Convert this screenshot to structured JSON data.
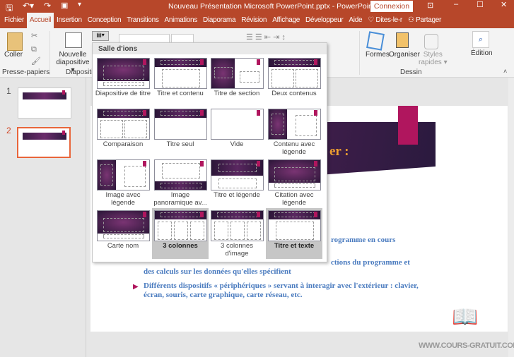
{
  "window": {
    "title": "Nouveau Présentation Microsoft PowerPoint.pptx  -  PowerPoint",
    "signin": "Connexion"
  },
  "tabs": [
    "Fichier",
    "Accueil",
    "Insertion",
    "Conception",
    "Transitions",
    "Animations",
    "Diaporama",
    "Révision",
    "Affichage",
    "Développeur",
    "Aide"
  ],
  "tell_me": "Dites-le-r",
  "share": "Partager",
  "ribbon": {
    "paste": "Coller",
    "new_slide_1": "Nouvelle",
    "new_slide_2": "diapositive ▾",
    "shapes": "Formes",
    "arrange": "Organiser",
    "styles_1": "Styles",
    "styles_2": "rapides ▾",
    "editing": "Édition",
    "groups": {
      "clipboard": "Presse-papiers",
      "slides": "Diapositiv",
      "drawing": "Dessin"
    }
  },
  "thumbnails": [
    {
      "num": "1"
    },
    {
      "num": "2"
    }
  ],
  "layout_gallery": {
    "header": "Salle d'ions",
    "items": [
      {
        "label": "Diapositive de titre",
        "type": "title"
      },
      {
        "label": "Titre et contenu",
        "type": "content"
      },
      {
        "label": "Titre de section",
        "type": "section"
      },
      {
        "label": "Deux contenus",
        "type": "two"
      },
      {
        "label": "Comparaison",
        "type": "two"
      },
      {
        "label": "Titre seul",
        "type": "titleonly"
      },
      {
        "label": "Vide",
        "type": "blank"
      },
      {
        "label": "Contenu avec légende",
        "type": "caption"
      },
      {
        "label": "Image avec légende",
        "type": "caption"
      },
      {
        "label": "Image panoramique av...",
        "type": "pano"
      },
      {
        "label": "Titre et légende",
        "type": "tl"
      },
      {
        "label": "Citation avec légende",
        "type": "title"
      },
      {
        "label": "Carte nom",
        "type": "title"
      },
      {
        "label": "3 colonnes",
        "type": "three",
        "selected": true
      },
      {
        "label": "3 colonnes d'image",
        "type": "three"
      },
      {
        "label": "Titre et texte",
        "type": "content",
        "selected": true
      }
    ]
  },
  "slide": {
    "title_fragment": "er :",
    "bullets": [
      "rogramme en cours",
      "ctions du programme et",
      "des calculs sur les données qu'elles spécifient",
      "Différents dispositifs « périphériques » servant à interagir avec l'extérieur : clavier,",
      "écran, souris, carte graphique, carte réseau, etc."
    ]
  },
  "watermark": "WWW.COURS-GRATUIT.COM",
  "colors": {
    "accent": "#b7472a",
    "slide_title": "#f0a030",
    "bullet_text": "#4a7bbf",
    "bullet_marker": "#b0165e"
  }
}
